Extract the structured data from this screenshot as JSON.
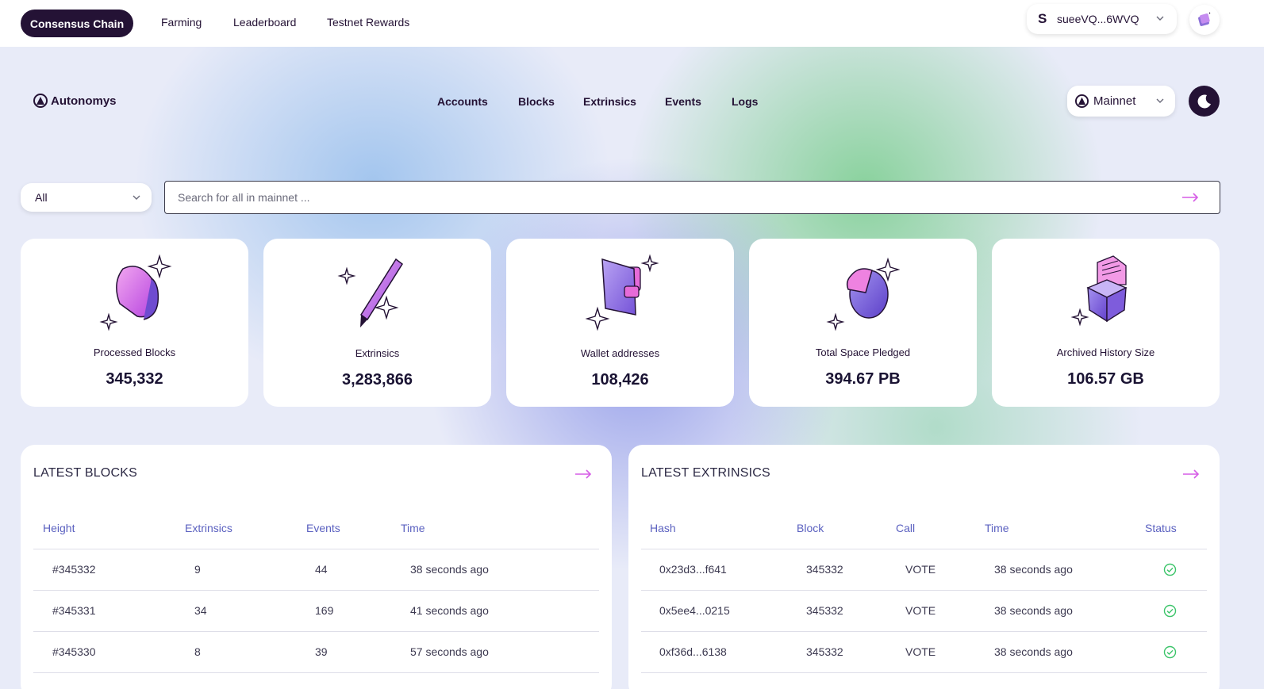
{
  "topbar": {
    "active_tab": "Consensus Chain",
    "tabs": [
      "Farming",
      "Leaderboard",
      "Testnet Rewards"
    ],
    "wallet_address": "sueeVQ...6WVQ"
  },
  "header": {
    "brand": "Autonomys",
    "nav": [
      "Accounts",
      "Blocks",
      "Extrinsics",
      "Events",
      "Logs"
    ],
    "network": "Mainnet"
  },
  "search": {
    "filter": "All",
    "placeholder": "Search for all in mainnet ..."
  },
  "stats": [
    {
      "label": "Processed Blocks",
      "value": "345,332",
      "icon": "cube-icon"
    },
    {
      "label": "Extrinsics",
      "value": "3,283,866",
      "icon": "pen-icon"
    },
    {
      "label": "Wallet addresses",
      "value": "108,426",
      "icon": "wallet-icon"
    },
    {
      "label": "Total Space Pledged",
      "value": "394.67 PB",
      "icon": "pie-icon"
    },
    {
      "label": "Archived History Size",
      "value": "106.57 GB",
      "icon": "box-icon"
    }
  ],
  "latest_blocks": {
    "title": "LATEST BLOCKS",
    "columns": [
      "Height",
      "Extrinsics",
      "Events",
      "Time"
    ],
    "rows": [
      {
        "height": "#345332",
        "extrinsics": "9",
        "events": "44",
        "time": "38 seconds ago"
      },
      {
        "height": "#345331",
        "extrinsics": "34",
        "events": "169",
        "time": "41 seconds ago"
      },
      {
        "height": "#345330",
        "extrinsics": "8",
        "events": "39",
        "time": "57 seconds ago"
      }
    ]
  },
  "latest_extrinsics": {
    "title": "LATEST EXTRINSICS",
    "columns": [
      "Hash",
      "Block",
      "Call",
      "Time",
      "Status"
    ],
    "rows": [
      {
        "hash": "0x23d3...f641",
        "block": "345332",
        "call": "VOTE",
        "time": "38 seconds ago",
        "status": "success"
      },
      {
        "hash": "0x5ee4...0215",
        "block": "345332",
        "call": "VOTE",
        "time": "38 seconds ago",
        "status": "success"
      },
      {
        "hash": "0xf36d...6138",
        "block": "345332",
        "call": "VOTE",
        "time": "38 seconds ago",
        "status": "success"
      }
    ]
  },
  "colors": {
    "primary": "#241235",
    "accent_arrow": "#d65ce6",
    "table_header": "#5b61c0",
    "success": "#3cc46a"
  }
}
